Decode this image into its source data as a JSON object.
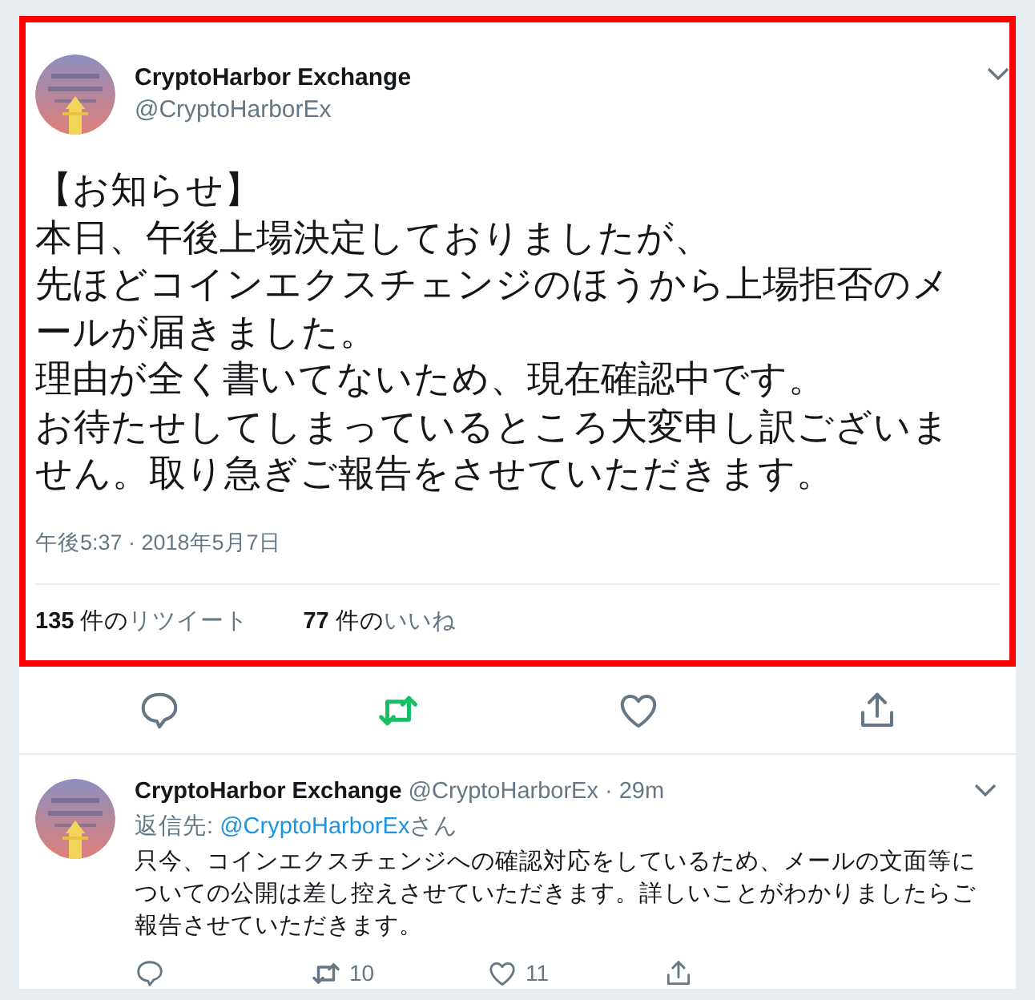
{
  "main_tweet": {
    "highlighted": true,
    "author": {
      "name": "CryptoHarbor Exchange",
      "handle": "@CryptoHarborEx"
    },
    "text_lines": [
      "【お知らせ】",
      "本日、午後上場決定しておりましたが、",
      "先ほどコインエクスチェンジのほうから上場拒否のメールが届きました。",
      "理由が全く書いてないため、現在確認中です。",
      "お待たせしてしまっているところ大変申し訳ございません。取り急ぎご報告をさせていただきます。"
    ],
    "timestamp": "午後5:37 · 2018年5月7日",
    "stats": [
      {
        "count": "135",
        "unit": "件の",
        "label": "リツイート"
      },
      {
        "count": "77",
        "unit": "件の",
        "label": "いいね"
      }
    ]
  },
  "actions": [
    {
      "kind": "reply",
      "active": false
    },
    {
      "kind": "retweet",
      "active": true
    },
    {
      "kind": "like",
      "active": false
    },
    {
      "kind": "share",
      "active": false
    }
  ],
  "reply_tweet": {
    "author": {
      "name": "CryptoHarbor Exchange",
      "handle": "@CryptoHarborEx"
    },
    "separator": "·",
    "time": "29m",
    "reply_to_label": "返信先:",
    "reply_to": "@CryptoHarborEx",
    "reply_to_suffix": "さん",
    "text": "只今、コインエクスチェンジへの確認対応をしているため、メールの文面等についての公開は差し控えさせていただきます。詳しいことがわかりましたらご報告させていただきます。",
    "actions": [
      {
        "kind": "reply"
      },
      {
        "kind": "retweet",
        "count": "10"
      },
      {
        "kind": "like",
        "count": "11"
      },
      {
        "kind": "share"
      }
    ]
  }
}
